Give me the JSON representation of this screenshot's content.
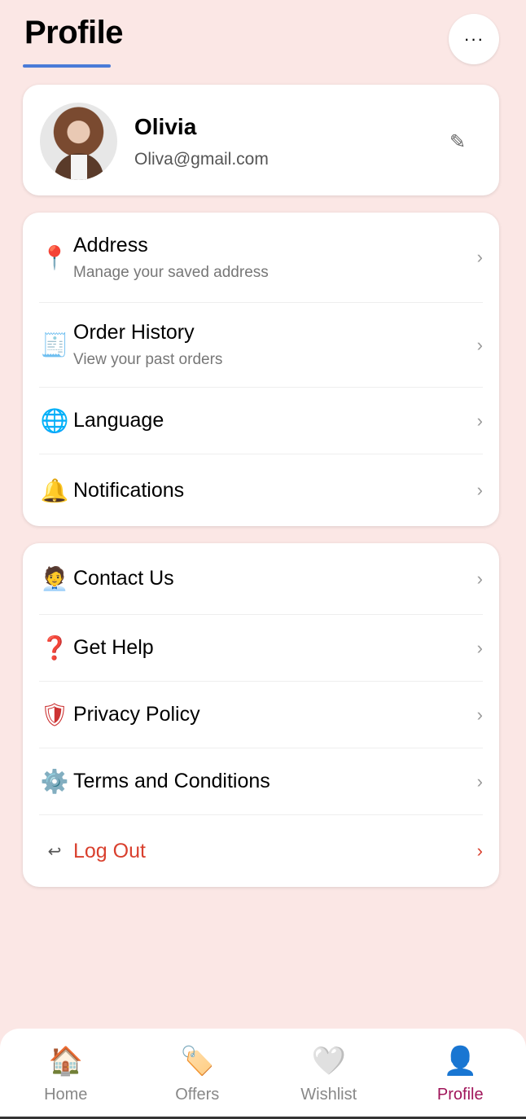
{
  "header": {
    "title": "Profile",
    "more_icon": "more-horizontal-icon",
    "more_label": "···"
  },
  "user": {
    "name": "Olivia",
    "email": "Oliva@gmail.com",
    "edit_glyph": "✎"
  },
  "menu1": [
    {
      "icon": "📍",
      "label": "Address",
      "sub": "Manage your saved address"
    },
    {
      "icon": "🧾",
      "label": "Order History",
      "sub": "View your past orders"
    },
    {
      "icon": "🌐",
      "label": "Language"
    },
    {
      "icon": "🔔",
      "label": "Notifications"
    }
  ],
  "menu2": [
    {
      "icon": "🧑‍💼",
      "label": "Contact Us"
    },
    {
      "icon": "❓",
      "label": "Get Help"
    },
    {
      "icon": "🛡",
      "label": "Privacy Policy"
    },
    {
      "icon": "⚙️",
      "label": "Terms and Conditions"
    },
    {
      "icon": "↩",
      "label": "Log Out"
    }
  ],
  "chevron": "›",
  "nav": [
    {
      "icon": "🏠",
      "label": "Home"
    },
    {
      "icon": "🏷️",
      "label": "Offers"
    },
    {
      "icon": "🤍",
      "label": "Wishlist"
    },
    {
      "icon": "👤",
      "label": "Profile",
      "active": true
    }
  ],
  "colors": {
    "background": "#fbe7e5",
    "accent": "#4a7bd8",
    "logout": "#d9402e",
    "active_tab": "#a0155a"
  }
}
